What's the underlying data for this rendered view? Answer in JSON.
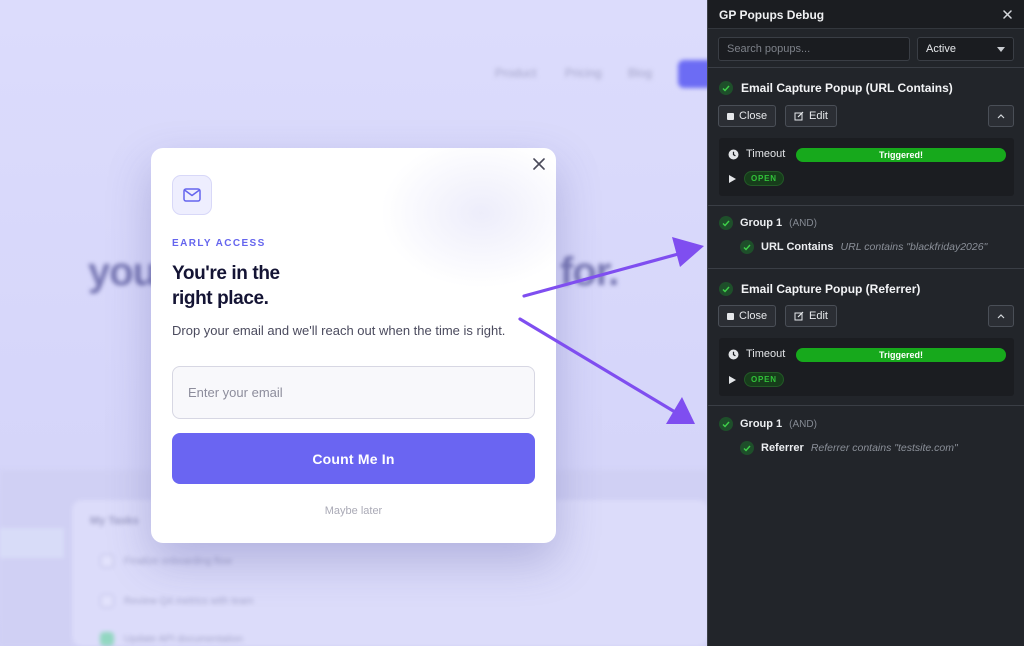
{
  "background": {
    "nav": [
      "Product",
      "Pricing",
      "Blog"
    ],
    "hero_left": "you",
    "hero_right": "for.",
    "card_title": "My Tasks",
    "tasks": [
      {
        "label": "Finalize onboarding flow",
        "done": false
      },
      {
        "label": "Review Q4 metrics with team",
        "done": false
      },
      {
        "label": "Update API documentation",
        "done": true
      }
    ]
  },
  "modal": {
    "eyebrow": "EARLY ACCESS",
    "headline_line1": "You're in the",
    "headline_line2": "right place.",
    "subtext": "Drop your email and we'll reach out when the time is right.",
    "email_placeholder": "Enter your email",
    "submit_label": "Count Me In",
    "dismiss_label": "Maybe later",
    "accent": "#6a65f2"
  },
  "panel": {
    "title": "GP Popups Debug",
    "search_placeholder": "Search popups...",
    "filter_value": "Active",
    "popups": [
      {
        "title": "Email Capture Popup (URL Contains)",
        "close_label": "Close",
        "edit_label": "Edit",
        "trigger_label": "Timeout",
        "trigger_status": "Triggered!",
        "state_badge": "OPEN",
        "group_name": "Group 1",
        "group_op": "(AND)",
        "condition_name": "URL Contains",
        "condition_desc": "URL contains \"blackfriday2026\""
      },
      {
        "title": "Email Capture Popup (Referrer)",
        "close_label": "Close",
        "edit_label": "Edit",
        "trigger_label": "Timeout",
        "trigger_status": "Triggered!",
        "state_badge": "OPEN",
        "group_name": "Group 1",
        "group_op": "(AND)",
        "condition_name": "Referrer",
        "condition_desc": "Referrer contains \"testsite.com\""
      }
    ],
    "colors": {
      "triggered": "#17a91c",
      "arrow": "#7f4ef0"
    }
  }
}
